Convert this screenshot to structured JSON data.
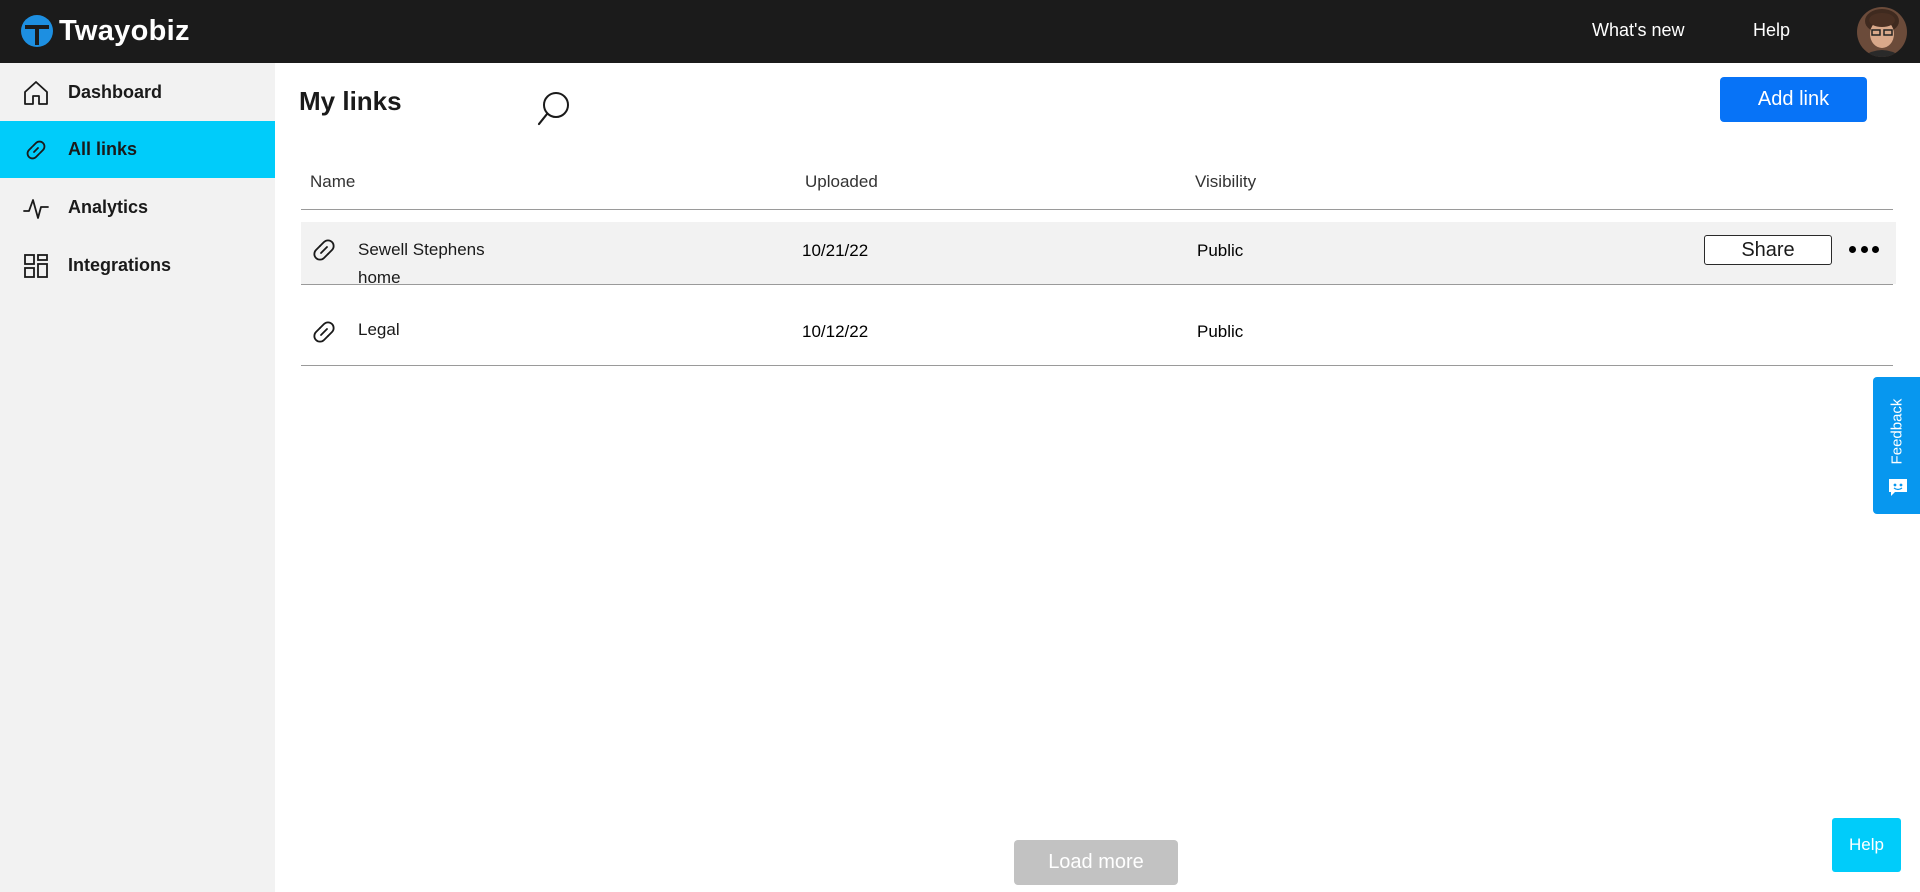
{
  "app": {
    "name": "Twayobiz"
  },
  "topnav": {
    "whats_new": "What's new",
    "help": "Help"
  },
  "sidebar": {
    "items": [
      {
        "label": "Dashboard",
        "icon": "home-icon",
        "active": false
      },
      {
        "label": "All links",
        "icon": "link-icon",
        "active": true
      },
      {
        "label": "Analytics",
        "icon": "pulse-icon",
        "active": false
      },
      {
        "label": "Integrations",
        "icon": "grid-icon",
        "active": false
      }
    ]
  },
  "main": {
    "title": "My links",
    "add_button": "Add link",
    "columns": {
      "name": "Name",
      "uploaded": "Uploaded",
      "visibility": "Visibility"
    },
    "rows": [
      {
        "name_line1": "Sewell Stephens",
        "name_line2": "home",
        "uploaded": "10/21/22",
        "visibility": "Public",
        "share_label": "Share"
      },
      {
        "name": "Legal",
        "uploaded": "10/12/22",
        "visibility": "Public"
      }
    ],
    "load_more": "Load more"
  },
  "feedback": {
    "label": "Feedback"
  },
  "help_button": "Help",
  "colors": {
    "topbar": "#1b1b1b",
    "sidebar_bg": "#f2f2f2",
    "active_item": "#00ccfa",
    "primary_button": "#0773f7",
    "feedback_tab": "#0797ef",
    "logo_blue": "#1d8fe1"
  }
}
